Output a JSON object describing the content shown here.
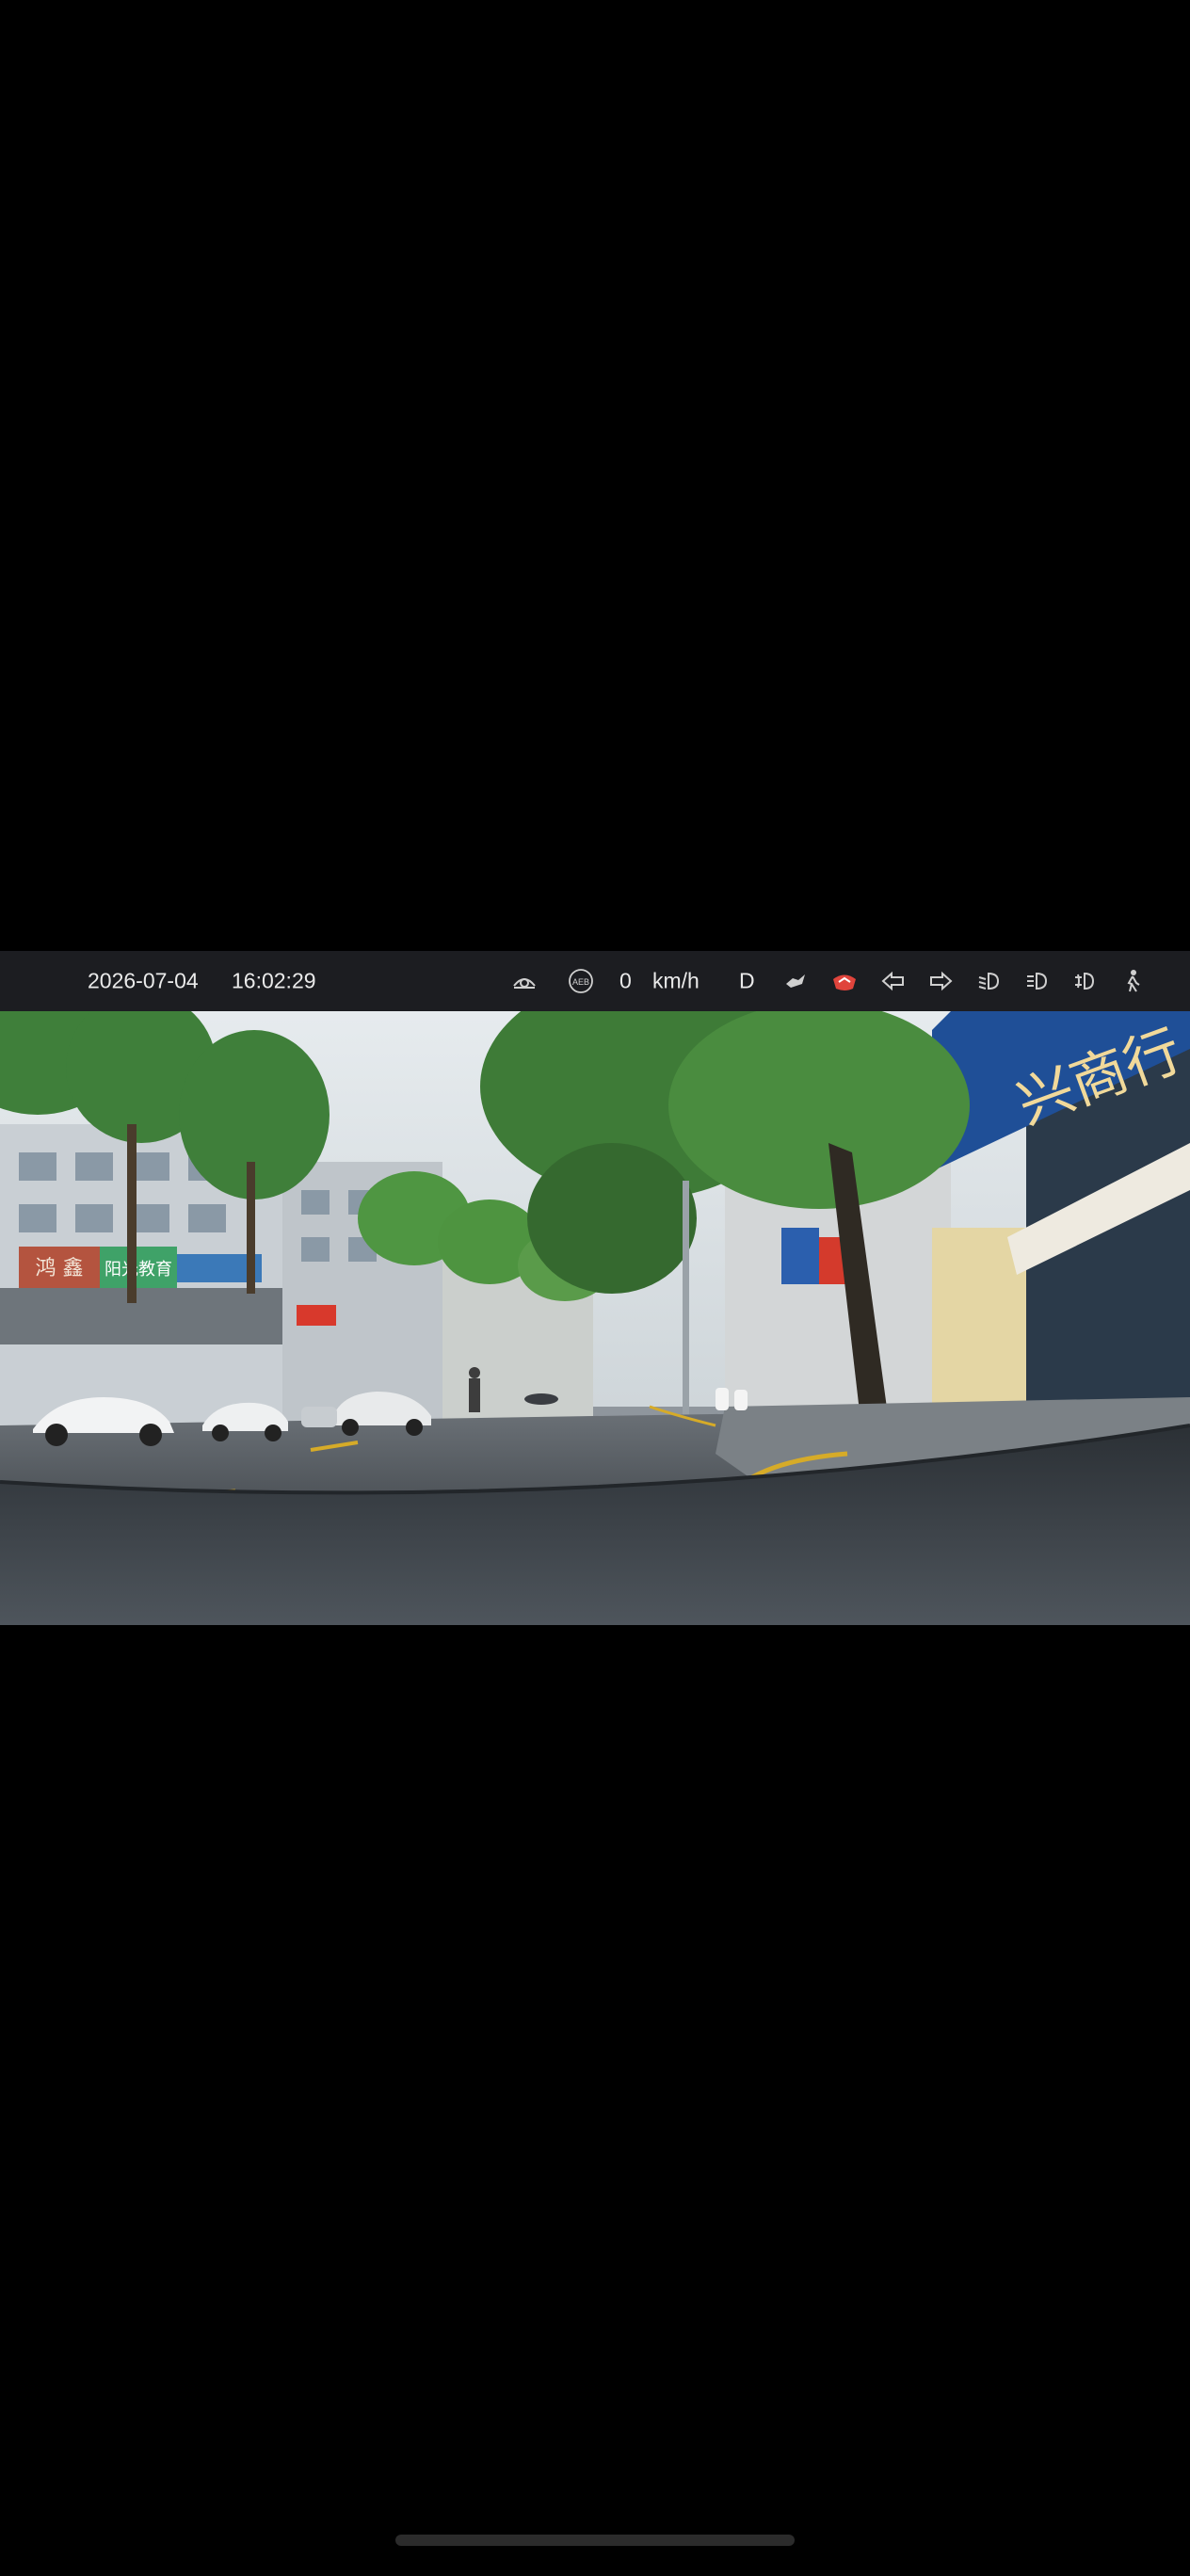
{
  "status_bar": {
    "date": "2026-07-04",
    "time": "16:02:29",
    "speed": "0",
    "speed_unit": "km/h",
    "gear": "D",
    "icons": [
      "steering-assist-icon",
      "aeb-icon",
      "hands-off-icon",
      "seatbelt-warning-icon",
      "left-turn-signal-icon",
      "right-turn-signal-icon",
      "low-beam-icon",
      "high-beam-icon",
      "fog-light-icon",
      "pedestrian-warning-icon"
    ],
    "aeb_label": "AEB",
    "warning_color": "#e0443c"
  },
  "camera": {
    "shop_sign_1": "鸿 鑫",
    "shop_sign_2": "阳光教育",
    "shop_sign_3": "兴商行"
  }
}
